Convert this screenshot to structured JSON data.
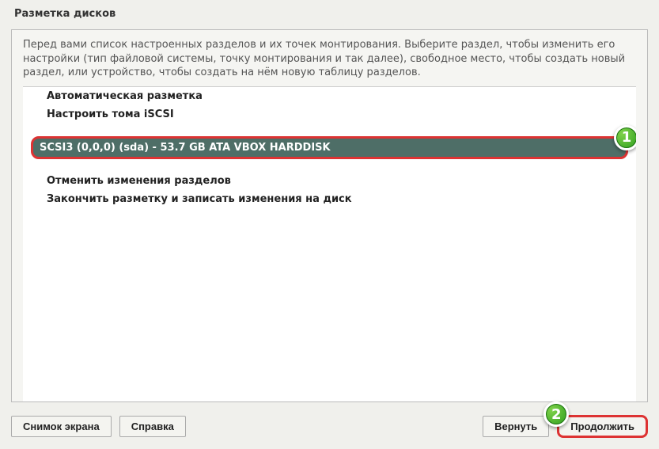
{
  "title": "Разметка дисков",
  "instructions": "Перед вами список настроенных разделов и их точек монтирования. Выберите раздел, чтобы изменить его настройки (тип файловой системы, точку монтирования и так далее), свободное место, чтобы создать новый раздел, или устройство, чтобы создать на нём новую таблицу разделов.",
  "items": {
    "guided": "Автоматическая разметка",
    "iscsi": "Настроить тома iSCSI",
    "disk": "SCSI3 (0,0,0) (sda) - 53.7 GB ATA VBOX HARDDISK",
    "undo": "Отменить изменения разделов",
    "finish": "Закончить разметку и записать изменения на диск"
  },
  "buttons": {
    "screenshot": "Снимок экрана",
    "help": "Справка",
    "back": "Вернуть",
    "continue": "Продолжить"
  },
  "callouts": {
    "one": "1",
    "two": "2"
  }
}
